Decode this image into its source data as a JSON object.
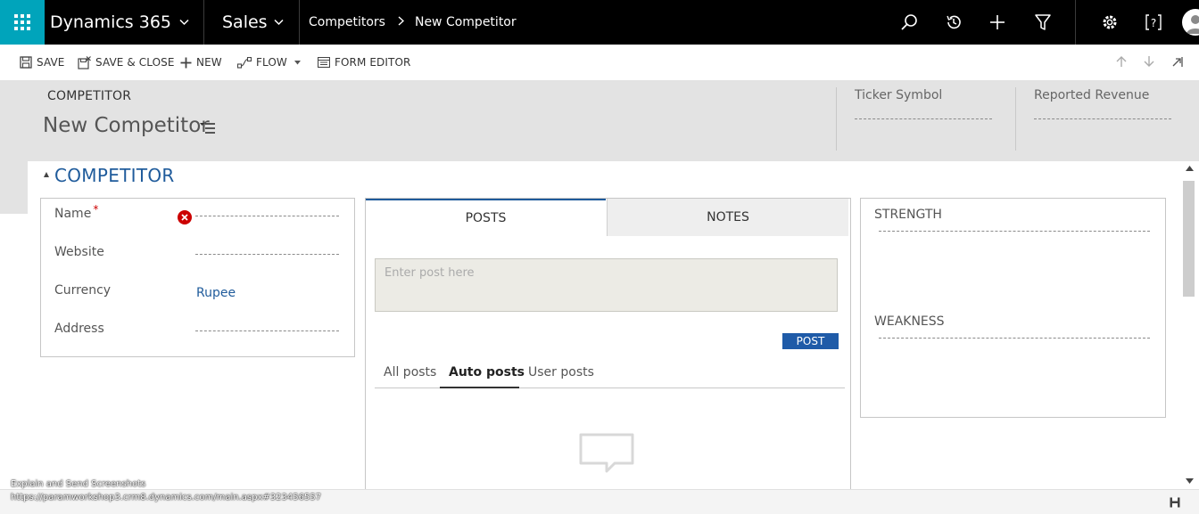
{
  "nav": {
    "brand": "Dynamics 365",
    "app": "Sales",
    "breadcrumb": [
      "Competitors",
      "New Competitor"
    ],
    "icons": [
      "search-icon",
      "recent-icon",
      "add-icon",
      "filter-icon",
      "settings-icon",
      "help-icon",
      "avatar-icon"
    ]
  },
  "toolbar": {
    "save": "SAVE",
    "save_close": "SAVE & CLOSE",
    "new": "NEW",
    "flow": "FLOW",
    "form_editor": "FORM EDITOR"
  },
  "header": {
    "entity": "COMPETITOR",
    "title": "New Competitor",
    "fields": [
      {
        "label": "Ticker Symbol",
        "value": ""
      },
      {
        "label": "Reported Revenue",
        "value": ""
      }
    ]
  },
  "section": {
    "title": "COMPETITOR"
  },
  "fields": {
    "name": {
      "label": "Name",
      "required": "*",
      "value": ""
    },
    "website": {
      "label": "Website",
      "value": ""
    },
    "currency": {
      "label": "Currency",
      "value": "Rupee"
    },
    "address": {
      "label": "Address",
      "value": ""
    }
  },
  "social": {
    "tabs": [
      "POSTS",
      "NOTES"
    ],
    "active_tab": "POSTS",
    "post_placeholder": "Enter post here",
    "post_button": "POST",
    "post_filters": [
      "All posts",
      "Auto posts",
      "User posts"
    ],
    "active_filter": "Auto posts"
  },
  "analysis": {
    "strength_label": "STRENGTH",
    "weakness_label": "WEAKNESS"
  },
  "overlay": {
    "line1": "Explain and Send Screenshots",
    "line2": "https://paramworkshop3.crm8.dynamics.com/main.aspx#323456557"
  },
  "colors": {
    "nav_bg": "#000000",
    "waffle_bg": "#00a4bb",
    "accent_blue": "#1f5b9b",
    "post_button": "#1f5ba8",
    "error_red": "#cc0000",
    "header_bg": "#e3e3e3"
  }
}
